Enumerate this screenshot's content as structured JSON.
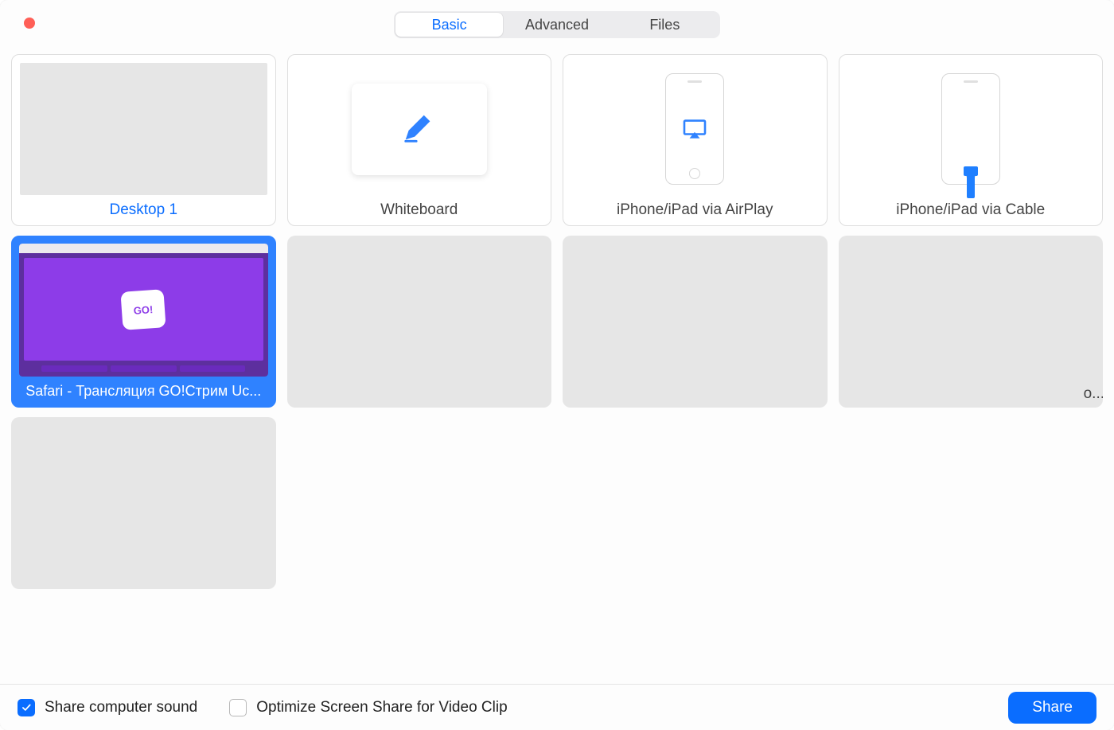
{
  "tabs": {
    "basic": "Basic",
    "advanced": "Advanced",
    "files": "Files",
    "active": "basic"
  },
  "options": {
    "desktop": "Desktop 1",
    "whiteboard": "Whiteboard",
    "airplay": "iPhone/iPad via AirPlay",
    "cable": "iPhone/iPad via Cable"
  },
  "windows": {
    "selected": "Safari - Трансляция GO!Стрим Uc...",
    "trail": "o...",
    "go_badge": "GO!"
  },
  "footer": {
    "share_sound": "Share computer sound",
    "optimize": "Optimize Screen Share for Video Clip",
    "share_btn": "Share",
    "sound_checked": true,
    "optimize_checked": false
  }
}
